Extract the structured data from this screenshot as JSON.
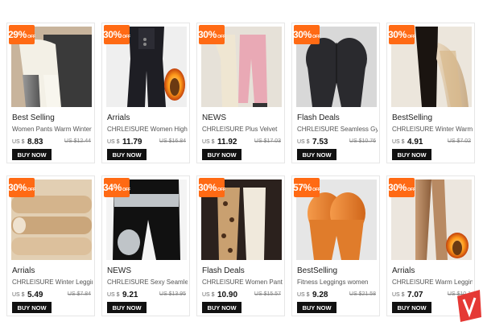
{
  "products": [
    {
      "badge": "29%",
      "off": "OFF",
      "tag": "Best Selling",
      "name": "Women Pants Warm Winter",
      "currency": "US $",
      "price": "8.83",
      "old_price": "US $12.44",
      "buy": "BUY NOW",
      "image": "fleece-legging-photo"
    },
    {
      "badge": "30%",
      "off": "OFF",
      "tag": "Arrials",
      "name": "CHRLEISURE Women High",
      "currency": "US $",
      "price": "11.79",
      "old_price": "US $16.84",
      "buy": "BUY NOW",
      "image": "high-waist-legging-photo"
    },
    {
      "badge": "30%",
      "off": "OFF",
      "tag": "NEWS",
      "name": "CHRLEISURE Plus Velvet",
      "currency": "US $",
      "price": "11.92",
      "old_price": "US $17.03",
      "buy": "BUY NOW",
      "image": "velvet-jogger-photo"
    },
    {
      "badge": "30%",
      "off": "OFF",
      "tag": "Flash Deals",
      "name": "CHRLEISURE Seamless Gym",
      "currency": "US $",
      "price": "7.53",
      "old_price": "US $10.76",
      "buy": "BUY NOW",
      "image": "seamless-gym-legging-photo"
    },
    {
      "badge": "30%",
      "off": "OFF",
      "tag": "BestSelling",
      "name": "CHRLEISURE Winter Warm",
      "currency": "US $",
      "price": "4.91",
      "old_price": "US $7.02",
      "buy": "BUY NOW",
      "image": "sheer-tights-photo"
    },
    {
      "badge": "30%",
      "off": "OFF",
      "tag": "Arrials",
      "name": "CHRLEISURE Winter Leggings",
      "currency": "US $",
      "price": "5.49",
      "old_price": "US $7.84",
      "buy": "BUY NOW",
      "image": "beige-fleece-photo"
    },
    {
      "badge": "34%",
      "off": "OFF",
      "tag": "NEWS",
      "name": "CHRLEISURE Sexy Seamless",
      "currency": "US $",
      "price": "9.21",
      "old_price": "US $13.95",
      "buy": "BUY NOW",
      "image": "sauna-legging-photo"
    },
    {
      "badge": "30%",
      "off": "OFF",
      "tag": "Flash Deals",
      "name": "CHRLEISURE Women Pants",
      "currency": "US $",
      "price": "10.90",
      "old_price": "US $15.57",
      "buy": "BUY NOW",
      "image": "leopard-legging-photo"
    },
    {
      "badge": "57%",
      "off": "OFF",
      "tag": "BestSelling",
      "name": "Fitness Leggings women",
      "currency": "US $",
      "price": "9.28",
      "old_price": "US $21.58",
      "buy": "BUY NOW",
      "image": "orange-legging-photo"
    },
    {
      "badge": "30%",
      "off": "OFF",
      "tag": "Arrials",
      "name": "CHRLEISURE Warm Leggings",
      "currency": "US $",
      "price": "7.07",
      "old_price": "US $10.1",
      "buy": "BUY NOW",
      "image": "nude-tights-photo"
    }
  ],
  "colors": {
    "badge": "#ff6a14",
    "button": "#111111",
    "logo": "#e53935"
  }
}
